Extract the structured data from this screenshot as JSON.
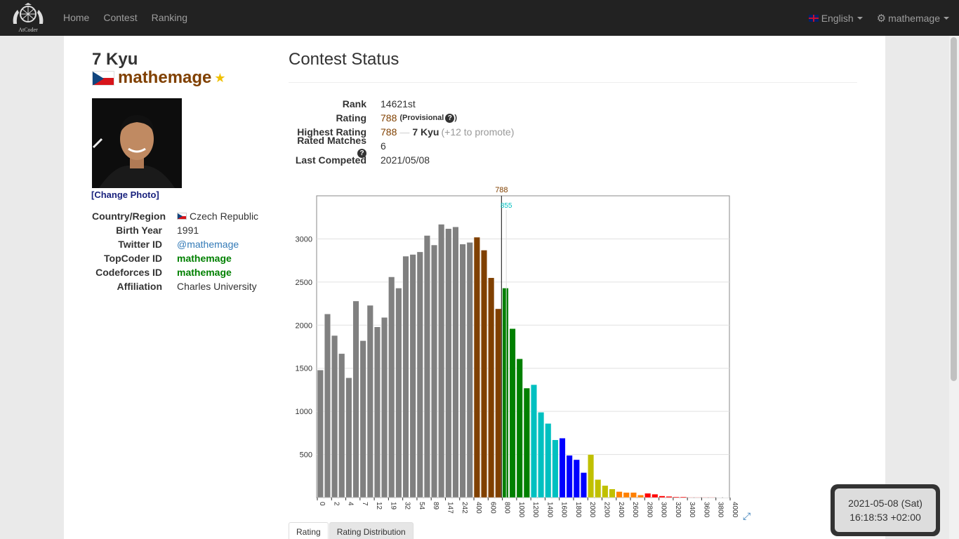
{
  "navbar": {
    "logo_text": "AtCoder",
    "links": [
      "Home",
      "Contest",
      "Ranking"
    ],
    "language": "English",
    "user": "mathemage"
  },
  "profile": {
    "kyu": "7 Kyu",
    "username": "mathemage",
    "change_photo": "[Change Photo]",
    "info": [
      {
        "label": "Country/Region",
        "value": "Czech Republic"
      },
      {
        "label": "Birth Year",
        "value": "1991"
      },
      {
        "label": "Twitter ID",
        "value": "@mathemage"
      },
      {
        "label": "TopCoder ID",
        "value": "mathemage"
      },
      {
        "label": "Codeforces ID",
        "value": "mathemage"
      },
      {
        "label": "Affiliation",
        "value": "Charles University"
      }
    ]
  },
  "status": {
    "title": "Contest Status",
    "rank_label": "Rank",
    "rank": "14621st",
    "rating_label": "Rating",
    "rating": "788",
    "provisional": "(Provisional",
    "provisional_close": ")",
    "highest_label": "Highest Rating",
    "highest": "788",
    "highest_sep": "—",
    "highest_kyu": "7 Kyu",
    "highest_promote": "(+12 to promote)",
    "rated_label": "Rated Matches",
    "rated": "6",
    "last_label": "Last Competed",
    "last": "2021/05/08"
  },
  "tabs": {
    "rating": "Rating",
    "distribution": "Rating Distribution"
  },
  "clock": {
    "date": "2021-05-08 (Sat)",
    "time": "16:18:53 +02:00"
  },
  "colors": {
    "grey": "#808080",
    "brown": "#804000",
    "green": "#008000",
    "cyan": "#00c0c0",
    "blue": "#0000ff",
    "yellow": "#c0c000",
    "orange": "#ff8000",
    "red": "#ff0000"
  },
  "chart_data": {
    "type": "bar",
    "title": "",
    "xlabel": "",
    "ylabel": "",
    "ylim": [
      0,
      3500
    ],
    "yticks": [
      500,
      1000,
      1500,
      2000,
      2500,
      3000
    ],
    "grid": true,
    "xtick_labels": [
      "0",
      "2",
      "4",
      "7",
      "12",
      "19",
      "32",
      "54",
      "89",
      "147",
      "242",
      "400",
      "600",
      "800",
      "1000",
      "1200",
      "1400",
      "1600",
      "1800",
      "2000",
      "2200",
      "2400",
      "2600",
      "2800",
      "3000",
      "3200",
      "3400",
      "3600",
      "3800",
      "4000"
    ],
    "markers": [
      {
        "label": "788",
        "value": 788,
        "color": "#804000"
      },
      {
        "label": "855",
        "value": 855,
        "color": "#00c0c0"
      }
    ],
    "series": [
      {
        "color_group": "grey",
        "values": [
          1480,
          2130,
          1880,
          1670,
          1390,
          2280,
          1820,
          2230,
          1980,
          2090,
          2560,
          2430,
          2800,
          2820,
          2850,
          3040,
          2930,
          3170,
          3120,
          3140,
          2940,
          2960
        ]
      },
      {
        "color_group": "brown",
        "values": [
          3020,
          2870,
          2550,
          2190
        ]
      },
      {
        "color_group": "green",
        "values": [
          2430,
          1960,
          1610,
          1270
        ]
      },
      {
        "color_group": "cyan",
        "values": [
          1310,
          990,
          860,
          670
        ]
      },
      {
        "color_group": "blue",
        "values": [
          690,
          490,
          440,
          290
        ]
      },
      {
        "color_group": "yellow",
        "values": [
          500,
          210,
          140,
          100
        ]
      },
      {
        "color_group": "orange",
        "values": [
          70,
          60,
          60,
          30
        ]
      },
      {
        "color_group": "red",
        "values": [
          50,
          40,
          20,
          15,
          10,
          10,
          5,
          5,
          5,
          5,
          3,
          3
        ]
      }
    ]
  }
}
